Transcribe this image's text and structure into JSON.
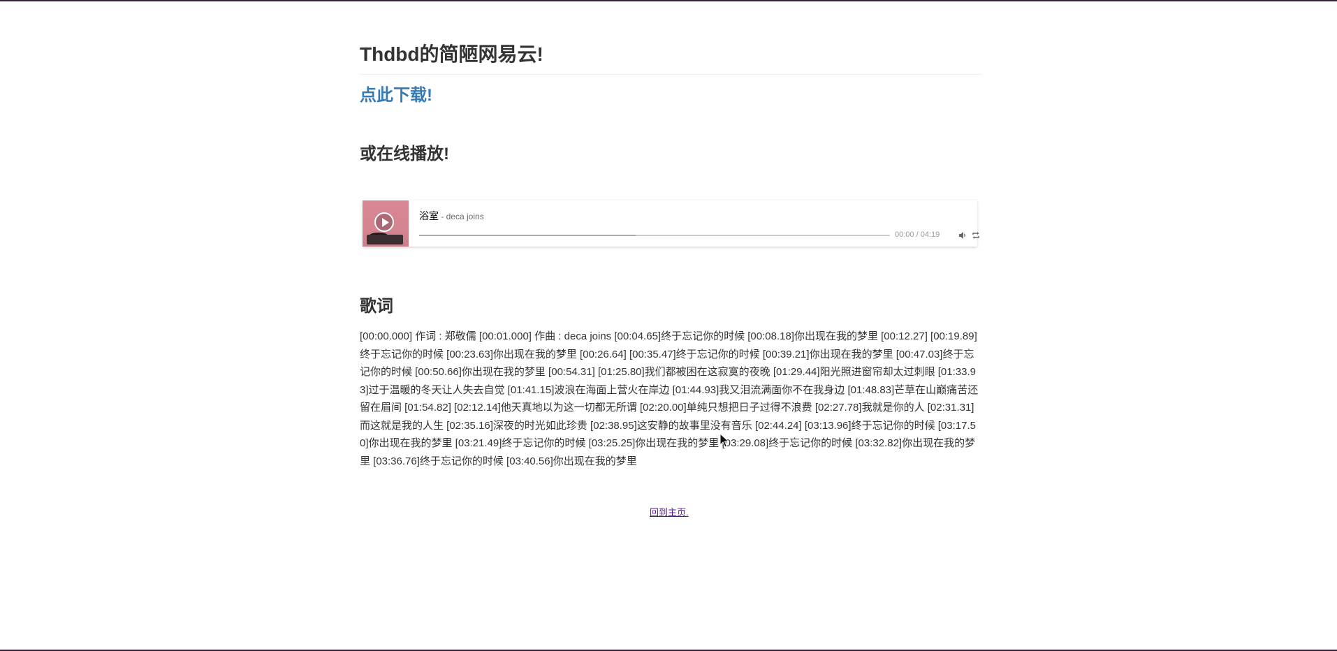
{
  "page": {
    "title": "Thdbd的简陋网易云!",
    "download_label": "点此下载!",
    "online_heading": "或在线播放!",
    "lyrics_heading": "歌词",
    "home_label": "回到主页."
  },
  "player": {
    "song_title": "浴室",
    "song_artist": " - deca joins",
    "time": "00:00 / 04:19",
    "loaded_fraction": 0.46
  },
  "lyrics": "[00:00.000] 作词 : 郑敬儒 [00:01.000] 作曲 : deca joins [00:04.65]终于忘记你的时候 [00:08.18]你出现在我的梦里 [00:12.27] [00:19.89]终于忘记你的时候 [00:23.63]你出现在我的梦里 [00:26.64] [00:35.47]终于忘记你的时候 [00:39.21]你出现在我的梦里 [00:47.03]终于忘记你的时候 [00:50.66]你出现在我的梦里 [00:54.31] [01:25.80]我们都被困在这寂寞的夜晚 [01:29.44]阳光照进窗帘却太过刺眼 [01:33.93]过于温暖的冬天让人失去自觉 [01:41.15]波浪在海面上营火在岸边 [01:44.93]我又泪流满面你不在我身边 [01:48.83]芒草在山巅痛苦还留在眉间 [01:54.82] [02:12.14]他天真地以为这一切都无所谓 [02:20.00]单纯只想把日子过得不浪费 [02:27.78]我就是你的人 [02:31.31]而这就是我的人生 [02:35.16]深夜的时光如此珍贵 [02:38.95]这安静的故事里没有音乐 [02:44.24] [03:13.96]终于忘记你的时候 [03:17.50]你出现在我的梦里 [03:21.49]终于忘记你的时候 [03:25.25]你出现在我的梦里 [03:29.08]终于忘记你的时候 [03:32.82]你出现在我的梦里 [03:36.76]终于忘记你的时候 [03:40.56]你出现在我的梦里",
  "icons": {
    "play": "play-icon",
    "volume": "volume-icon",
    "loop": "loop-icon",
    "cursor": "mouse-cursor-icon"
  },
  "colors": {
    "link": "#337ab7",
    "visited_link": "#551a8b",
    "cover": "#d98795",
    "frame": "#3a1f3f"
  }
}
